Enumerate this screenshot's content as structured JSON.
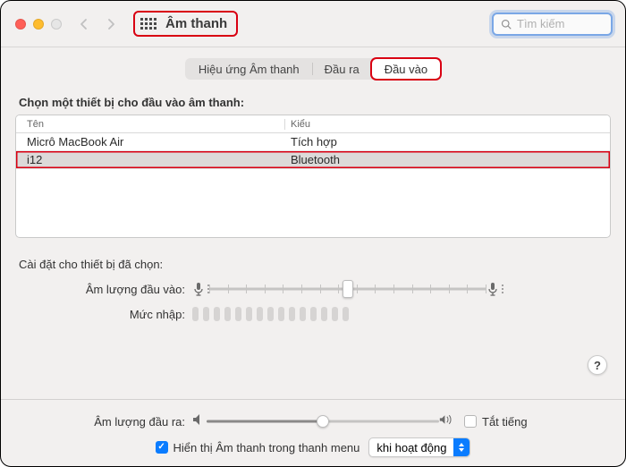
{
  "header": {
    "title": "Âm thanh",
    "search_placeholder": "Tìm kiếm"
  },
  "tabs": {
    "items": [
      "Hiệu ứng Âm thanh",
      "Đầu ra",
      "Đầu vào"
    ],
    "active_index": 2
  },
  "device_prompt": "Chọn một thiết bị cho đầu vào âm thanh:",
  "table": {
    "columns": {
      "name": "Tên",
      "type": "Kiểu"
    },
    "rows": [
      {
        "name": "Micrô MacBook Air",
        "type": "Tích hợp"
      },
      {
        "name": "i12",
        "type": "Bluetooth"
      }
    ],
    "selected_index": 1
  },
  "device_settings": {
    "heading": "Cài đặt cho thiết bị đã chọn:",
    "input_volume_label": "Âm lượng đầu vào:",
    "input_level_label": "Mức nhập:",
    "input_volume_value": 0.5
  },
  "help_label": "?",
  "footer": {
    "output_volume_label": "Âm lượng đầu ra:",
    "output_volume_value": 0.5,
    "mute_label": "Tắt tiếng",
    "mute_checked": false,
    "menubar_label": "Hiển thị Âm thanh trong thanh menu",
    "menubar_checked": true,
    "select_value": "khi hoạt động"
  }
}
